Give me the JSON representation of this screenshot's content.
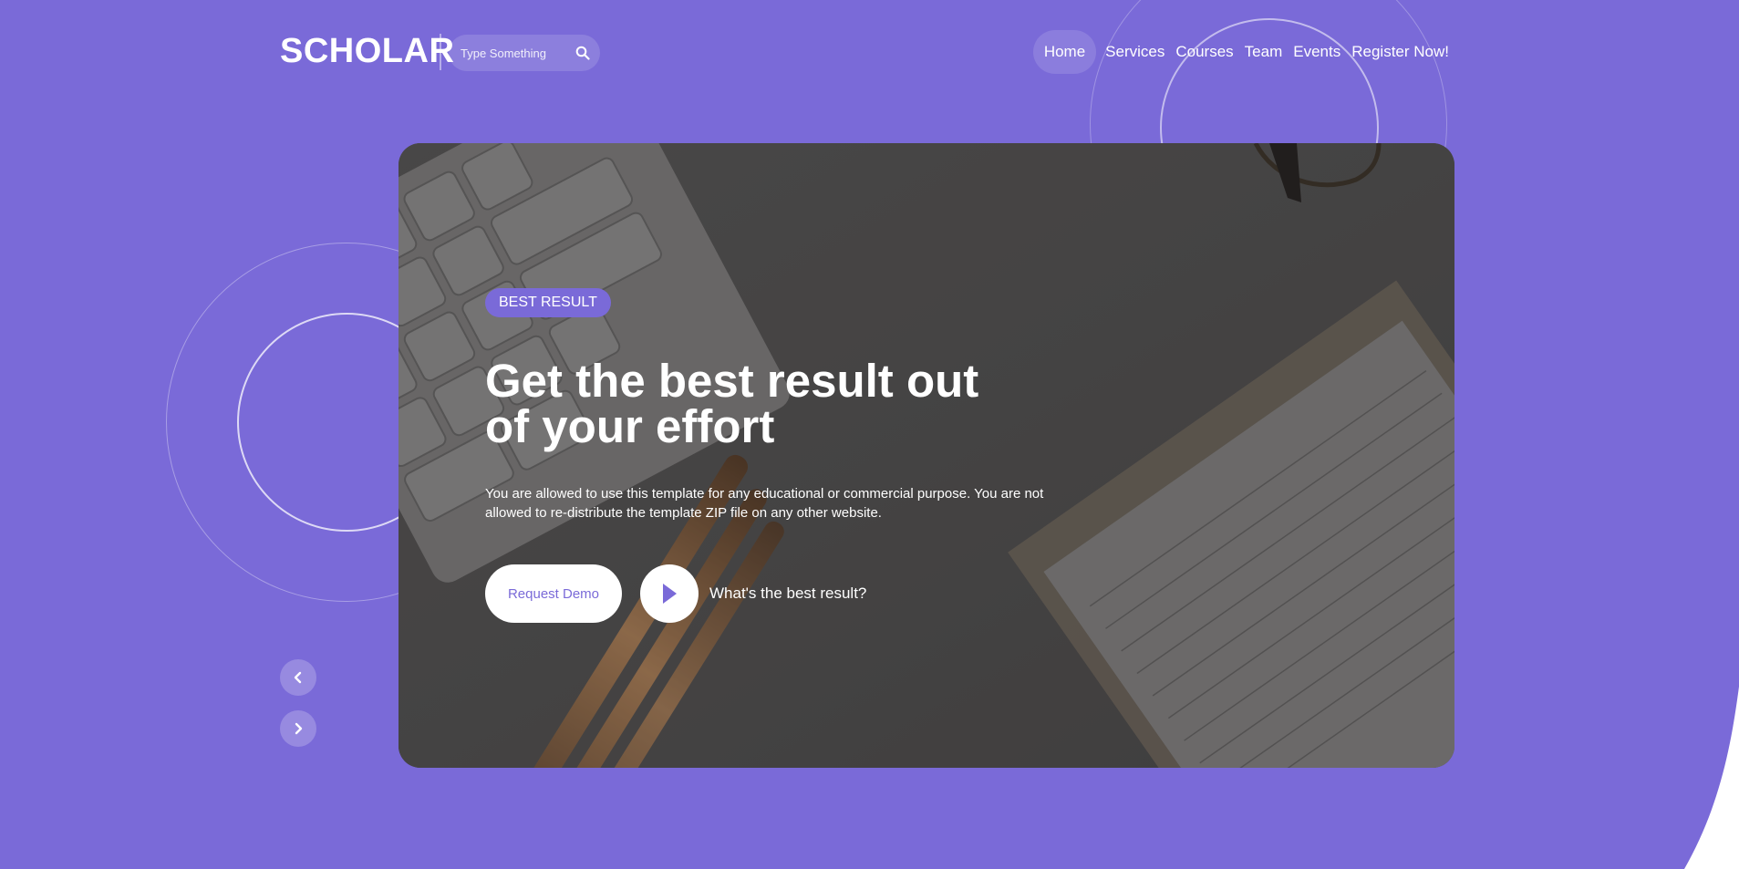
{
  "brand": {
    "name": "SCHOLAR"
  },
  "search": {
    "placeholder": "Type Something"
  },
  "nav": {
    "items": [
      {
        "label": "Home",
        "active": true
      },
      {
        "label": "Services",
        "active": false
      },
      {
        "label": "Courses",
        "active": false
      },
      {
        "label": "Team",
        "active": false
      },
      {
        "label": "Events",
        "active": false
      },
      {
        "label": "Register Now!",
        "active": false
      }
    ]
  },
  "hero": {
    "badge": "BEST RESULT",
    "headline": "Get the best result out of your effort",
    "description": "You are allowed to use this template for any educational or commercial purpose. You are not allowed to re-distribute the template ZIP file on any other website.",
    "primary_button": "Request Demo",
    "play_label": "What's the best result?"
  },
  "colors": {
    "background": "#7a6ad8",
    "accent": "#7a6ad8",
    "banner_overlay": "#4a4848"
  },
  "icons": {
    "search": "search-icon",
    "play": "play-icon",
    "prev": "chevron-left-icon",
    "next": "chevron-right-icon"
  }
}
